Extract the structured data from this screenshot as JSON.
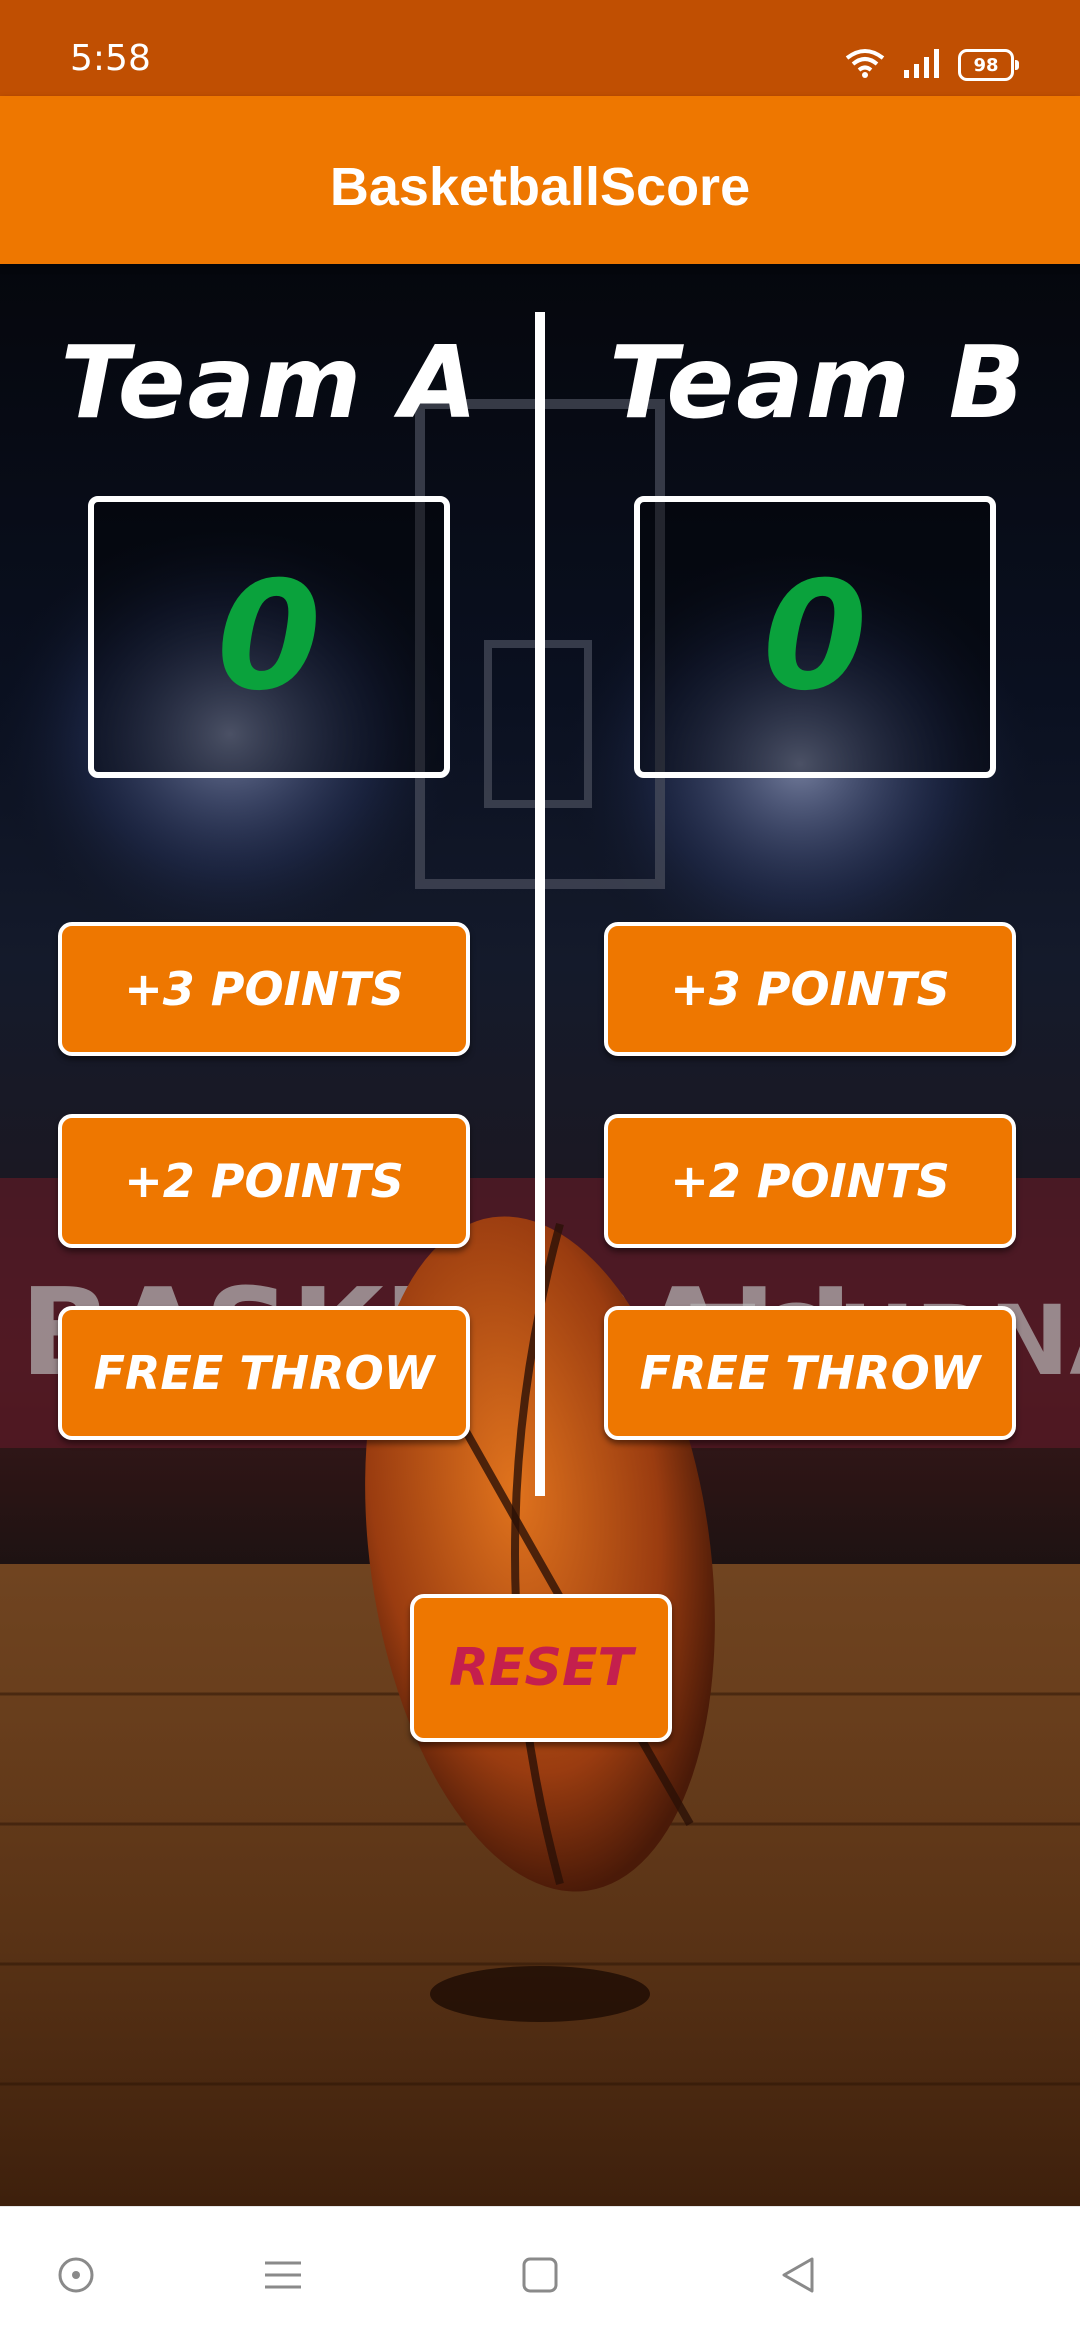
{
  "status_bar": {
    "time": "5:58",
    "battery": "98",
    "icons": [
      "wifi-icon",
      "signal-icon",
      "battery-icon"
    ]
  },
  "app_bar": {
    "title": "BasketballScore"
  },
  "team_a": {
    "name": "Team A",
    "score": "0",
    "buttons": {
      "three": "+3 POINTS",
      "two": "+2 POINTS",
      "free_throw": "FREE THROW"
    }
  },
  "team_b": {
    "name": "Team B",
    "score": "0",
    "buttons": {
      "three": "+3 POINTS",
      "two": "+2 POINTS",
      "free_throw": "FREE THROW"
    }
  },
  "reset": {
    "label": "RESET"
  },
  "nav_bar": {
    "icons": [
      "circle-dot-icon",
      "menu-icon",
      "square-icon",
      "back-triangle-icon"
    ]
  },
  "colors": {
    "status_bar": "#c04f02",
    "app_bar": "#ee7700",
    "button": "#ee7700",
    "score": "#0aa23c",
    "reset_text": "#c41f4d"
  }
}
